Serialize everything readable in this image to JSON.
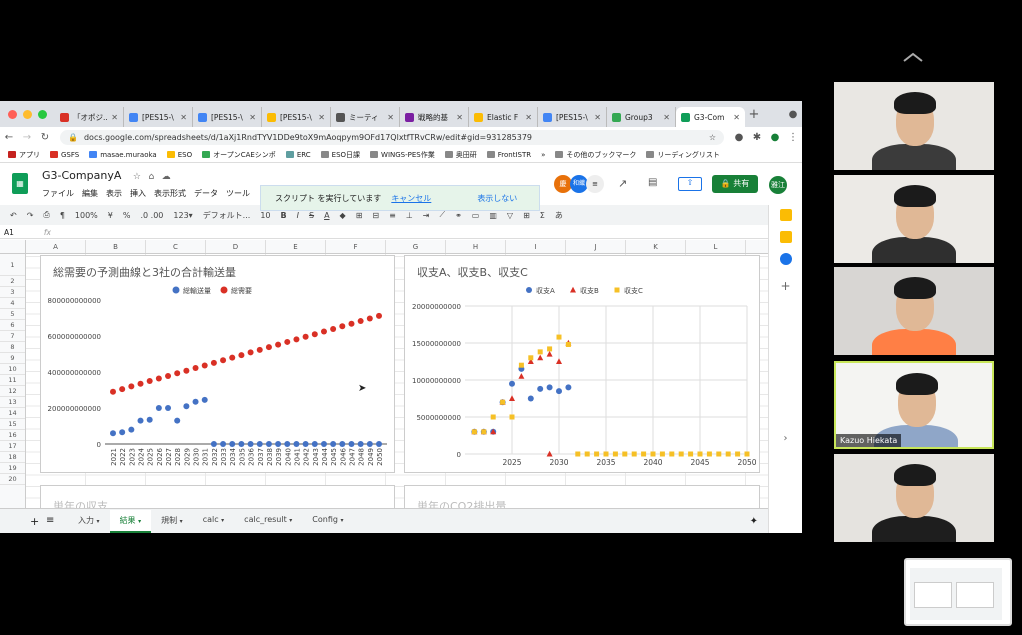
{
  "tabs": [
    {
      "title": "「オポジ...",
      "color": "#d93025"
    },
    {
      "title": "[PES15-\\",
      "color": "#4285f4"
    },
    {
      "title": "[PES15-\\",
      "color": "#4285f4"
    },
    {
      "title": "[PES15-\\",
      "color": "#fbbc04"
    },
    {
      "title": "ミーティ",
      "color": "#555555"
    },
    {
      "title": "戦略的基",
      "color": "#7b1fa2"
    },
    {
      "title": "Elastic F",
      "color": "#fbbc04"
    },
    {
      "title": "[PES15-\\",
      "color": "#4285f4"
    },
    {
      "title": "Group3",
      "color": "#34a853"
    },
    {
      "title": "G3-Com",
      "color": "#0f9d58"
    }
  ],
  "url": "docs.google.com/spreadsheets/d/1aXj1RndTYV1DDe9toX9mAoqpym9OFd17QlxtfTRvCRw/edit#gid=931285379",
  "bookmarks": [
    "アプリ",
    "GSFS",
    "masae.muraoka",
    "ESO",
    "オープンCAEシンポ",
    "ERC",
    "ESO日課",
    "WINGS-PES作業",
    "奥田研",
    "FrontISTR",
    "その他のブックマーク",
    "リーディングリスト"
  ],
  "bookmarks_more": "»",
  "doc": {
    "title": "G3-CompanyA",
    "menus": [
      "ファイル",
      "編集",
      "表示",
      "挿入",
      "表示形式",
      "データ",
      "ツール"
    ],
    "share": "共有",
    "user": "雅江"
  },
  "avatars": [
    {
      "label": "慶",
      "color": "#e8710a"
    },
    {
      "label": "和織",
      "color": "#1a73e8"
    }
  ],
  "toast": {
    "text": "スクリプト を実行しています",
    "cancel": "キャンセル",
    "dismiss": "表示しない"
  },
  "toolbar": {
    "zoom": "100%",
    "currency": "¥",
    "percent": "%",
    "decimals": ".0  .00",
    "format": "123▾",
    "font": "デフォルト...",
    "size": "10"
  },
  "cellref": "A1",
  "fx": "fx",
  "columns": [
    "A",
    "B",
    "C",
    "D",
    "E",
    "F",
    "G",
    "H",
    "I",
    "J",
    "K",
    "L"
  ],
  "rows": [
    "1",
    "2",
    "3",
    "4",
    "5",
    "6",
    "7",
    "8",
    "9",
    "10",
    "11",
    "12",
    "13",
    "14",
    "15",
    "16",
    "17",
    "18",
    "19",
    "20"
  ],
  "chart1": {
    "title": "総需要の予測曲線と3社の合計輸送量",
    "chart_data": {
      "type": "scatter",
      "title": "総需要の予測曲線と3社の合計輸送量",
      "legend": "top",
      "categories": [
        "2021",
        "2022",
        "2023",
        "2024",
        "2025",
        "2026",
        "2027",
        "2028",
        "2029",
        "2030",
        "2031",
        "2032",
        "2033",
        "2034",
        "2035",
        "2036",
        "2037",
        "2038",
        "2039",
        "2040",
        "2041",
        "2042",
        "2043",
        "2044",
        "2045",
        "2046",
        "2047",
        "2048",
        "2049",
        "2050"
      ],
      "series": [
        {
          "name": "総輸送量",
          "color": "#4472c4",
          "values": [
            60000000000,
            65000000000,
            80000000000,
            130000000000,
            135000000000,
            200000000000,
            200000000000,
            130000000000,
            210000000000,
            235000000000,
            245000000000,
            0,
            0,
            0,
            0,
            0,
            0,
            0,
            0,
            0,
            0,
            0,
            0,
            0,
            0,
            0,
            0,
            0,
            0,
            0
          ]
        },
        {
          "name": "総需要",
          "color": "#d93025",
          "values": [
            290000000000,
            305000000000,
            320000000000,
            335000000000,
            350000000000,
            364000000000,
            378000000000,
            393000000000,
            407000000000,
            422000000000,
            436000000000,
            451000000000,
            465000000000,
            480000000000,
            494000000000,
            509000000000,
            523000000000,
            538000000000,
            552000000000,
            567000000000,
            581000000000,
            596000000000,
            610000000000,
            625000000000,
            639000000000,
            654000000000,
            668000000000,
            683000000000,
            697000000000,
            712000000000
          ]
        }
      ],
      "ylim": [
        0,
        800000000000
      ],
      "yticks": [
        "0",
        "200000000000",
        "400000000000",
        "600000000000",
        "800000000000"
      ],
      "grid": false
    }
  },
  "chart2": {
    "title": "収支A、収支B、収支C",
    "chart_data": {
      "type": "scatter",
      "title": "収支A、収支B、収支C",
      "legend": "top",
      "series": [
        {
          "name": "収支A",
          "color": "#4472c4",
          "marker": "circle",
          "points": [
            [
              2021,
              3000000000
            ],
            [
              2022,
              3000000000
            ],
            [
              2023,
              3000000000
            ],
            [
              2024,
              7000000000
            ],
            [
              2025,
              9500000000
            ],
            [
              2026,
              11500000000
            ],
            [
              2027,
              7500000000
            ],
            [
              2028,
              8800000000
            ],
            [
              2029,
              9000000000
            ],
            [
              2030,
              8500000000
            ],
            [
              2031,
              9000000000
            ]
          ]
        },
        {
          "name": "収支B",
          "color": "#d93025",
          "marker": "triangle",
          "points": [
            [
              2021,
              3000000000
            ],
            [
              2022,
              3000000000
            ],
            [
              2023,
              3000000000
            ],
            [
              2024,
              7000000000
            ],
            [
              2025,
              7500000000
            ],
            [
              2026,
              10500000000
            ],
            [
              2027,
              12500000000
            ],
            [
              2028,
              13000000000
            ],
            [
              2029,
              13500000000
            ],
            [
              2030,
              12500000000
            ],
            [
              2031,
              15000000000
            ],
            [
              2029,
              0
            ]
          ]
        },
        {
          "name": "収支C",
          "color": "#f6c026",
          "marker": "square",
          "points": [
            [
              2021,
              3000000000
            ],
            [
              2022,
              3000000000
            ],
            [
              2023,
              5000000000
            ],
            [
              2024,
              7000000000
            ],
            [
              2025,
              5000000000
            ],
            [
              2026,
              12000000000
            ],
            [
              2027,
              13000000000
            ],
            [
              2028,
              13800000000
            ],
            [
              2029,
              14200000000
            ],
            [
              2030,
              15800000000
            ],
            [
              2031,
              14800000000
            ],
            [
              2032,
              0
            ],
            [
              2033,
              0
            ],
            [
              2034,
              0
            ],
            [
              2035,
              0
            ],
            [
              2036,
              0
            ],
            [
              2037,
              0
            ],
            [
              2038,
              0
            ],
            [
              2039,
              0
            ],
            [
              2040,
              0
            ],
            [
              2041,
              0
            ],
            [
              2042,
              0
            ],
            [
              2043,
              0
            ],
            [
              2044,
              0
            ],
            [
              2045,
              0
            ],
            [
              2046,
              0
            ],
            [
              2047,
              0
            ],
            [
              2048,
              0
            ],
            [
              2049,
              0
            ],
            [
              2050,
              0
            ]
          ]
        }
      ],
      "xlim": [
        2020,
        2050
      ],
      "xticks": [
        "2025",
        "2030",
        "2035",
        "2040",
        "2045",
        "2050"
      ],
      "ylim": [
        0,
        20000000000
      ],
      "yticks": [
        "0",
        "5000000000",
        "10000000000",
        "15000000000",
        "20000000000"
      ],
      "grid": true
    }
  },
  "chart3": {
    "title": "単年の収支"
  },
  "chart4": {
    "title": "単年のCO2排出量"
  },
  "sheets": [
    "入力",
    "結果",
    "規制",
    "calc",
    "calc_result",
    "Config"
  ],
  "active_sheet": "結果",
  "participants": [
    {
      "name": ""
    },
    {
      "name": ""
    },
    {
      "name": ""
    },
    {
      "name": "Kazuo Hiekata"
    },
    {
      "name": ""
    }
  ]
}
